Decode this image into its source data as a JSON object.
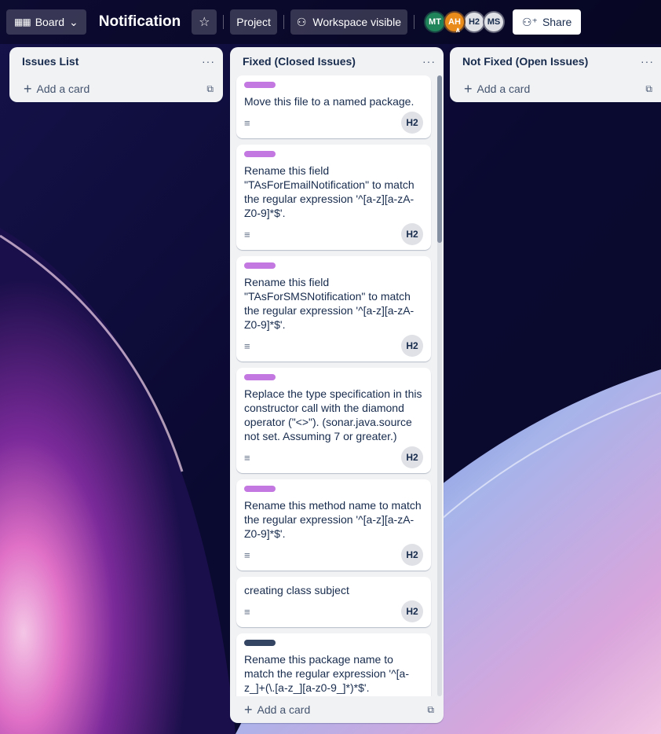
{
  "header": {
    "view_label": "Board",
    "board_title": "Notification",
    "project_label": "Project",
    "visibility_label": "Workspace visible",
    "share_label": "Share",
    "members": [
      "MT",
      "AH",
      "H2",
      "MS"
    ]
  },
  "lists": [
    {
      "title": "Issues List",
      "menu": "···",
      "add_label": "Add a card",
      "cards": []
    },
    {
      "title": "Fixed (Closed Issues)",
      "menu": "···",
      "add_label": "Add a card",
      "cards": [
        {
          "label_color": "#c377e0",
          "text": "Move this file to a named package.",
          "member": "H2"
        },
        {
          "label_color": "#c377e0",
          "text": "Rename this field \"TAsForEmailNotification\" to match the regular expression '^[a-z][a-zA-Z0-9]*$'.",
          "member": "H2"
        },
        {
          "label_color": "#c377e0",
          "text": "Rename this field \"TAsForSMSNotification\" to match the regular expression '^[a-z][a-zA-Z0-9]*$'.",
          "member": "H2"
        },
        {
          "label_color": "#c377e0",
          "text": "Replace the type specification in this constructor call with the diamond operator (\"<>\"). (sonar.java.source not set. Assuming 7 or greater.)",
          "member": "H2"
        },
        {
          "label_color": "#c377e0",
          "text": "Rename this method name to match the regular expression '^[a-z][a-zA-Z0-9]*$'.",
          "member": "H2"
        },
        {
          "label_color": "",
          "text": "creating class subject",
          "member": "H2"
        },
        {
          "label_color": "#344563",
          "text": "Rename this package name to match the regular expression '^[a-z_]+(\\.[a-z_][a-z0-9_]*)*$'.",
          "member": ""
        }
      ]
    },
    {
      "title": "Not Fixed (Open Issues)",
      "menu": "···",
      "add_label": "Add a card",
      "cards": []
    }
  ],
  "icons": {
    "view": "board-icon",
    "star": "star-icon",
    "visibility": "people-icon",
    "share": "add-person-icon",
    "description": "description-icon",
    "template": "template-icon",
    "add": "plus-icon"
  },
  "colors": {
    "label_purple": "#c377e0",
    "label_dark": "#344563",
    "share_bg": "#ffffff"
  }
}
